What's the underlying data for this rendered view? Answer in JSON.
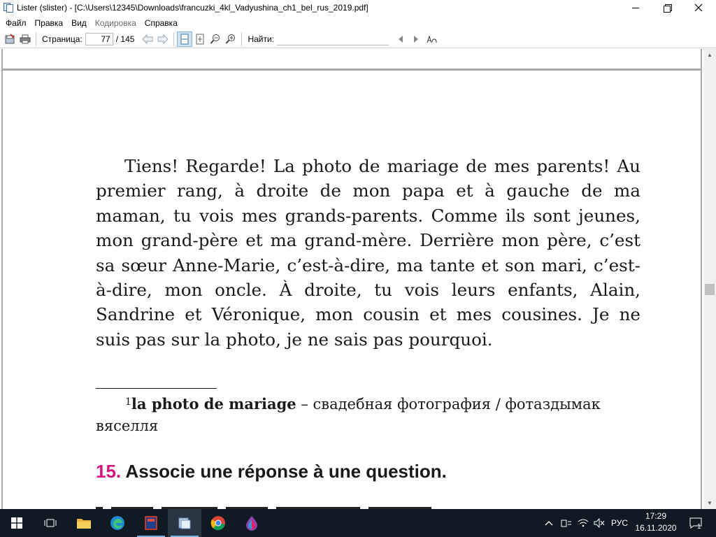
{
  "window": {
    "title": "Lister (slister) - [C:\\Users\\12345\\Downloads\\francuzki_4kl_Vadyushina_ch1_bel_rus_2019.pdf]"
  },
  "menu": [
    "Файл",
    "Правка",
    "Вид",
    "Кодировка",
    "Справка"
  ],
  "toolbar": {
    "page_label": "Страница:",
    "page_current": "77",
    "page_total": "/ 145",
    "find_label": "Найти:",
    "find_value": ""
  },
  "document": {
    "paragraph": "Tiens! Regarde! La photo de mariage de mes parents! Au premier rang, à droite de mon papa et à gauche de ma maman, tu vois mes grands-parents. Comme ils sont jeunes, mon grand-père et ma grand-mère. Derrière mon père, c’est sa sœur Anne-Marie, c’est-à-dire, ma tante et son mari, c’est-à-dire, mon oncle. À droite, tu vois leurs enfants, Alain, Sandrine et Véronique, mon cousin et mes cousines. Je ne suis pas sur la photo, je ne sais pas pourquoi.",
    "footnote_mark": "1",
    "footnote_term": "la photo de mariage",
    "footnote_text": " – свадебная фотография / фотаздымак вяселля",
    "exercise_number": "15.",
    "exercise_title": " Associe une réponse à une question."
  },
  "taskbar": {
    "lang": "РУС",
    "time": "17:29",
    "date": "16.11.2020",
    "notifications": "1"
  },
  "colors": {
    "accent_pink": "#d6157f",
    "taskbar": "#101a24"
  }
}
